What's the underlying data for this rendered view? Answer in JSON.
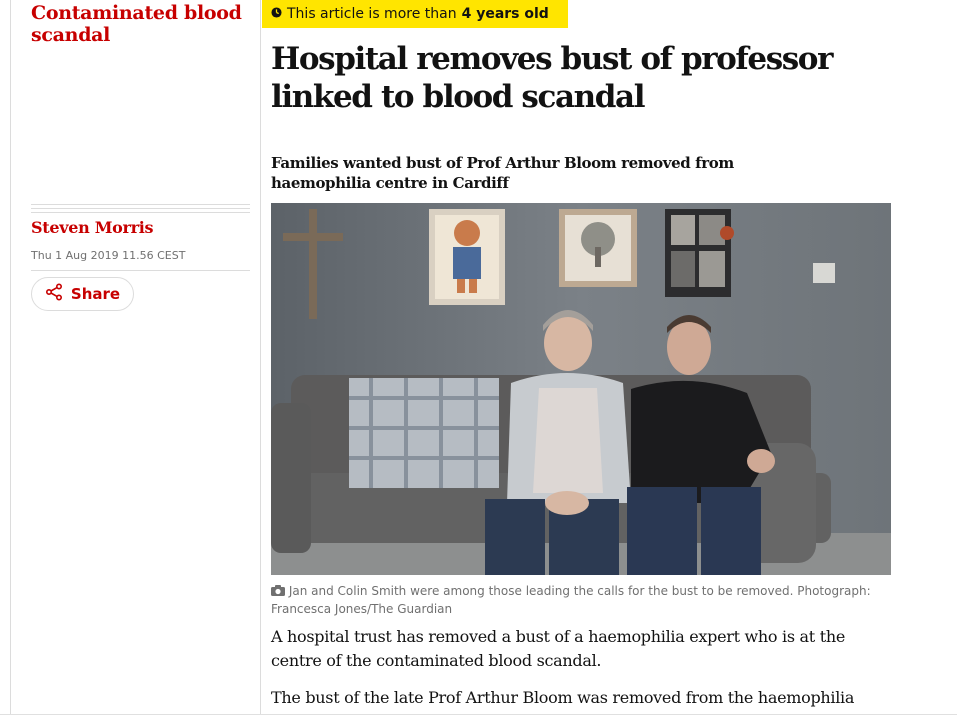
{
  "section": {
    "title": "Contaminated blood scandal"
  },
  "byline": {
    "author": "Steven Morris",
    "date": "Thu 1 Aug 2019 11.56 CEST",
    "share_label": "Share"
  },
  "age_notice": {
    "prefix": "This article is more than",
    "age": "4 years old"
  },
  "article": {
    "headline": "Hospital removes bust of professor linked to blood scandal",
    "standfirst": "Families wanted bust of Prof Arthur Bloom removed from haemophilia centre in Cardiff",
    "image_caption": "Jan and Colin Smith were among those leading the calls for the bust to be removed. Photograph: Francesca Jones/The Guardian",
    "paragraphs": [
      "A hospital trust has removed a bust of a haemophilia expert who is at the centre of the contaminated blood scandal.",
      "The bust of the late Prof Arthur Bloom was removed from the haemophilia"
    ]
  },
  "colors": {
    "accent_red": "#c70000",
    "badge_yellow": "#ffe500",
    "caption_grey": "#707070"
  },
  "icons": {
    "clock": "clock-icon",
    "share": "share-icon",
    "camera": "camera-icon"
  }
}
